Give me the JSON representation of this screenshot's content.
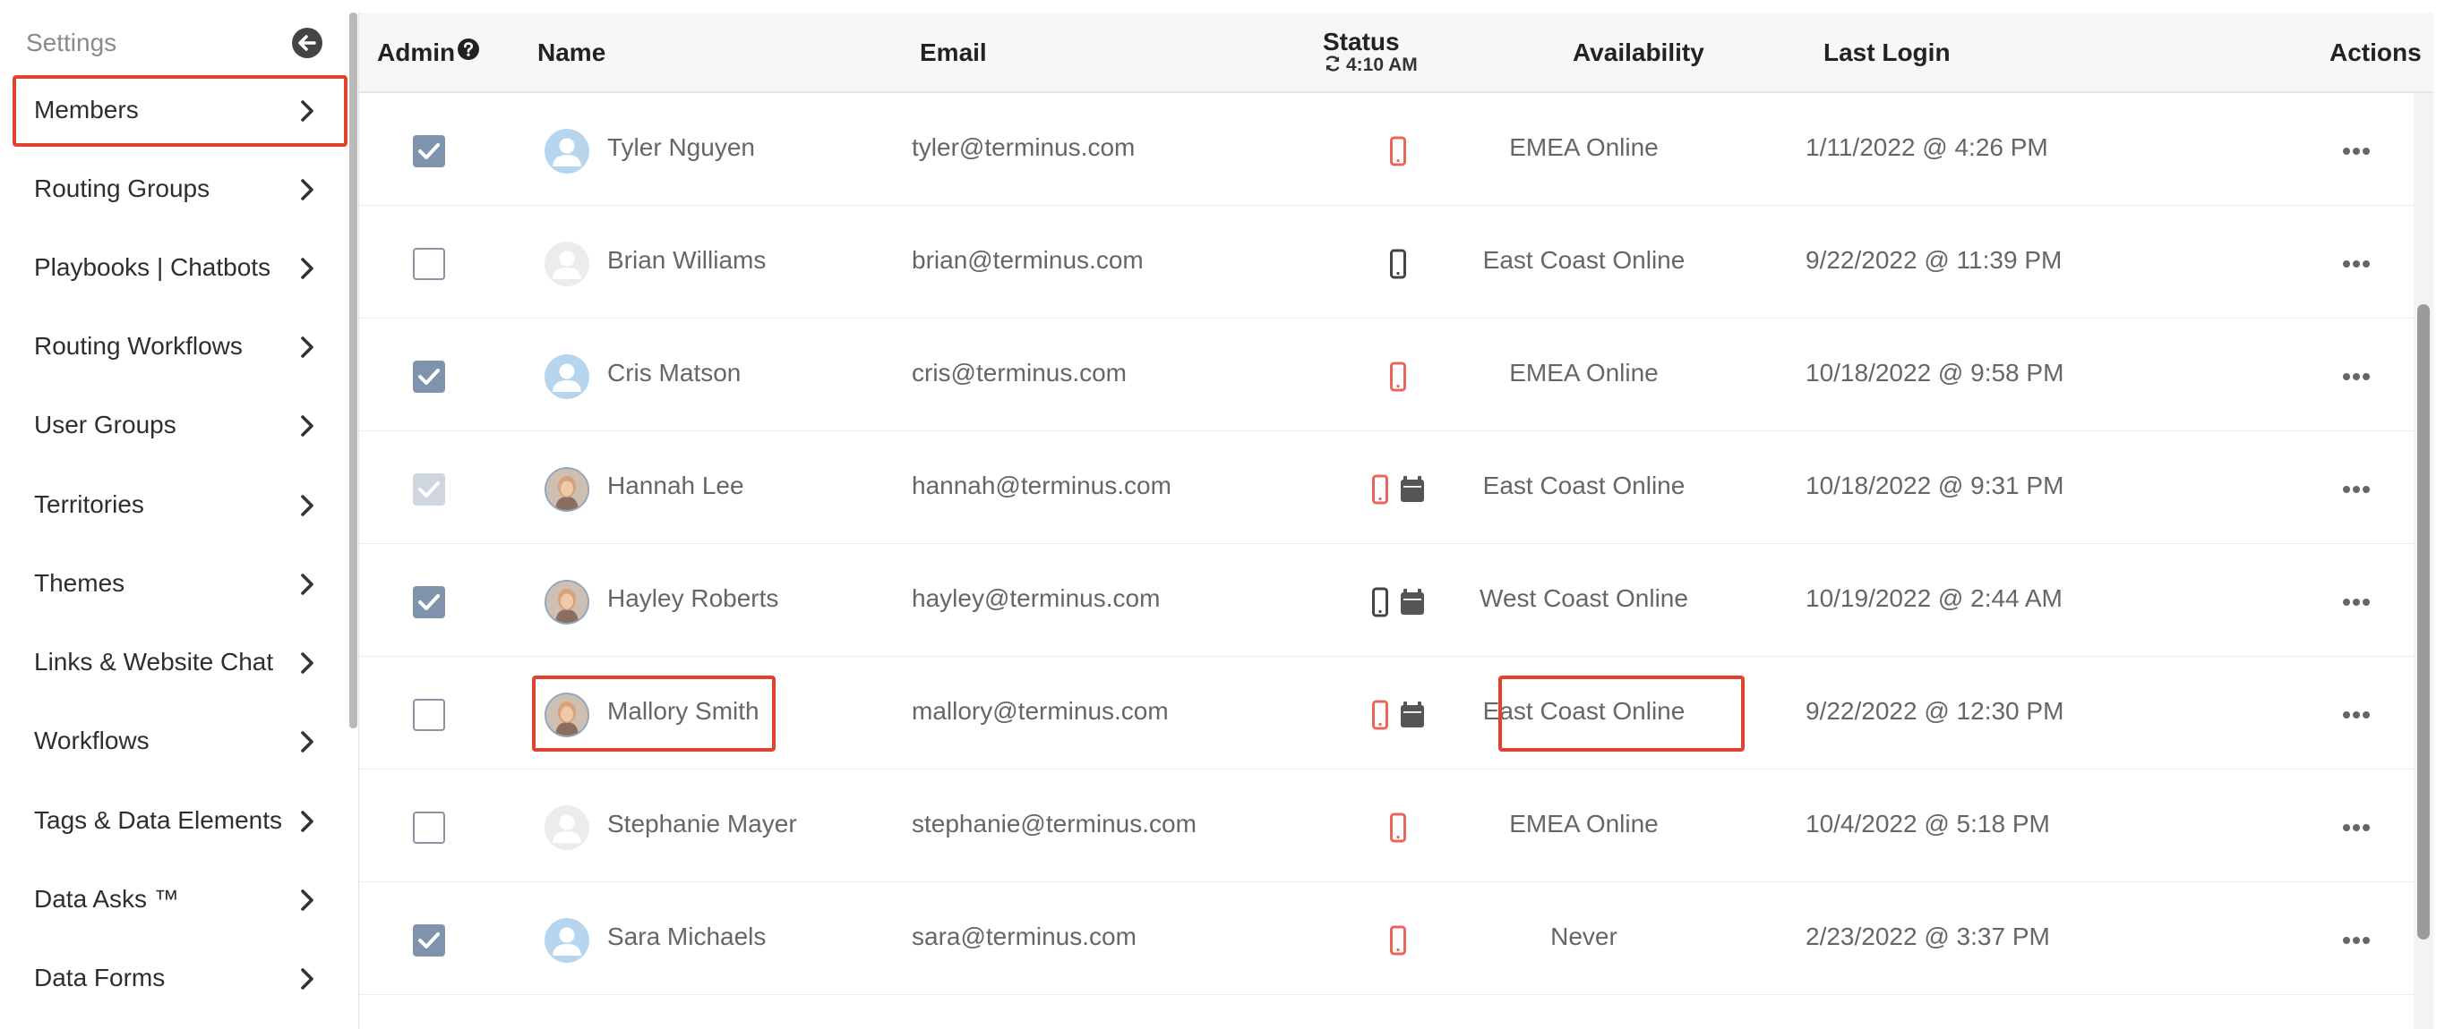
{
  "sidebar": {
    "title": "Settings",
    "items": [
      {
        "label": "Members",
        "selected": true
      },
      {
        "label": "Routing Groups"
      },
      {
        "label": "Playbooks | Chatbots"
      },
      {
        "label": "Routing Workflows"
      },
      {
        "label": "User Groups"
      },
      {
        "label": "Territories"
      },
      {
        "label": "Themes"
      },
      {
        "label": "Links & Website Chat"
      },
      {
        "label": "Workflows"
      },
      {
        "label": "Tags & Data Elements"
      },
      {
        "label": "Data Asks ™"
      },
      {
        "label": "Data Forms"
      }
    ]
  },
  "table": {
    "columns": {
      "admin": "Admin",
      "name": "Name",
      "email": "Email",
      "status": "Status",
      "status_time": "4:10 AM",
      "availability": "Availability",
      "last_login": "Last Login",
      "actions": "Actions"
    },
    "rows": [
      {
        "admin": "checked",
        "avatar": "default-blue",
        "name": "Tyler Nguyen",
        "email": "tyler@terminus.com",
        "status_icons": [
          "mobile-red"
        ],
        "availability": "EMEA Online",
        "last_login": "1/11/2022 @ 4:26 PM"
      },
      {
        "admin": "unchecked",
        "avatar": "default-gray",
        "name": "Brian Williams",
        "email": "brian@terminus.com",
        "status_icons": [
          "mobile-dark"
        ],
        "availability": "East Coast Online",
        "last_login": "9/22/2022 @ 11:39 PM"
      },
      {
        "admin": "checked",
        "avatar": "default-blue",
        "name": "Cris Matson",
        "email": "cris@terminus.com",
        "status_icons": [
          "mobile-red"
        ],
        "availability": "EMEA Online",
        "last_login": "10/18/2022 @ 9:58 PM"
      },
      {
        "admin": "checked-disabled",
        "avatar": "photo",
        "name": "Hannah Lee",
        "email": "hannah@terminus.com",
        "status_icons": [
          "mobile-red",
          "calendar"
        ],
        "availability": "East Coast Online",
        "last_login": "10/18/2022 @ 9:31 PM"
      },
      {
        "admin": "checked",
        "avatar": "photo",
        "name": "Hayley Roberts",
        "email": "hayley@terminus.com",
        "status_icons": [
          "mobile-dark",
          "calendar"
        ],
        "availability": "West Coast Online",
        "last_login": "10/19/2022 @ 2:44 AM"
      },
      {
        "admin": "unchecked",
        "avatar": "photo",
        "name": "Mallory Smith",
        "email": "mallory@terminus.com",
        "status_icons": [
          "mobile-red",
          "calendar"
        ],
        "availability": "East Coast Online",
        "last_login": "9/22/2022 @ 12:30 PM",
        "highlighted": true
      },
      {
        "admin": "unchecked",
        "avatar": "default-gray",
        "name": "Stephanie Mayer",
        "email": "stephanie@terminus.com",
        "status_icons": [
          "mobile-red"
        ],
        "availability": "EMEA Online",
        "last_login": "10/4/2022 @ 5:18 PM"
      },
      {
        "admin": "checked",
        "avatar": "default-blue",
        "name": "Sara Michaels",
        "email": "sara@terminus.com",
        "status_icons": [
          "mobile-red"
        ],
        "availability": "Never",
        "last_login": "2/23/2022 @ 3:37 PM"
      }
    ]
  },
  "colors": {
    "highlight": "#e0442e",
    "mobile_red": "#e8665a",
    "mobile_dark": "#444444",
    "checkbox_checked": "#8093ad",
    "avatar_blue": "#b7d6ee"
  }
}
